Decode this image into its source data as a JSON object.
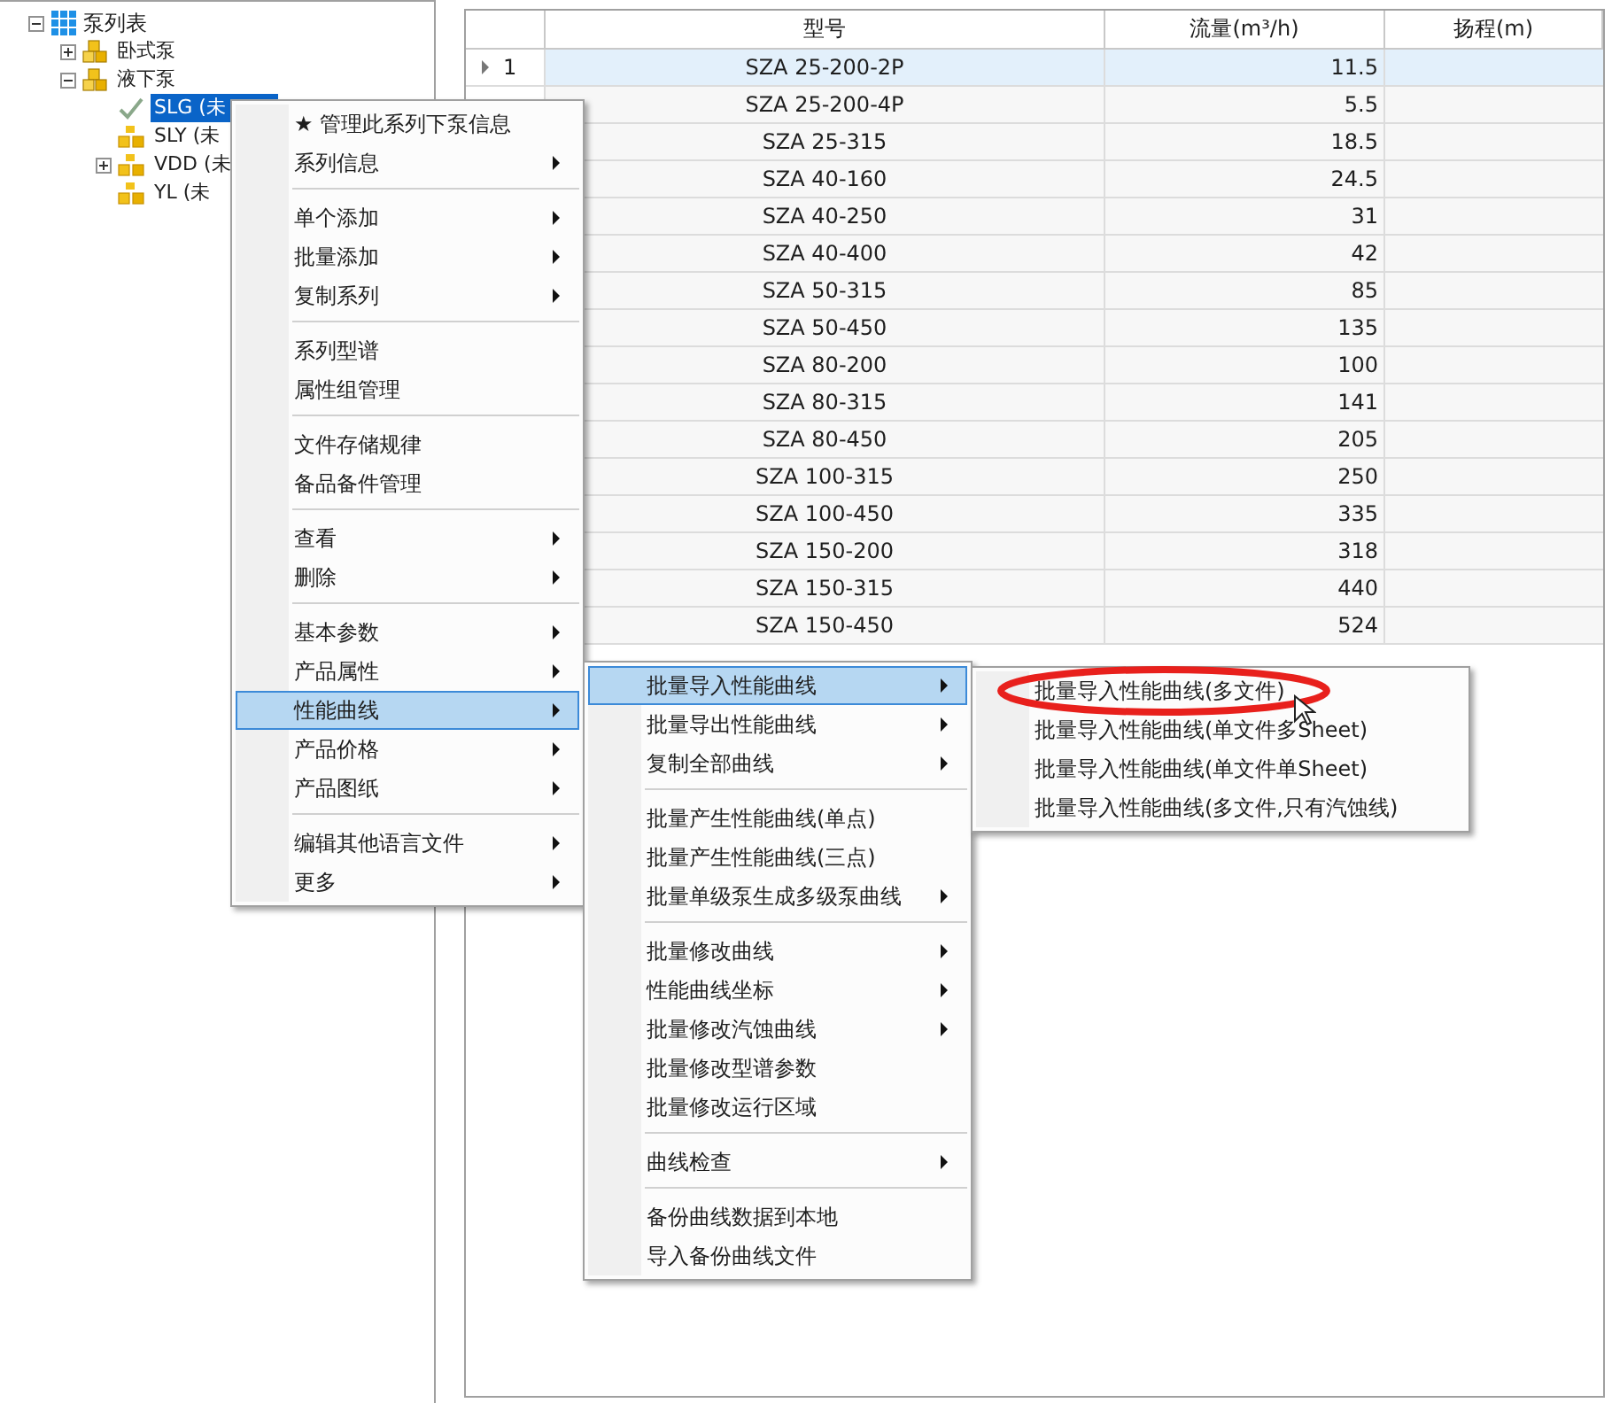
{
  "tree": {
    "label": "泵列表",
    "expanded": true,
    "children": [
      {
        "label": "卧式泵",
        "kind": "folder",
        "expanded": false,
        "has_children": true,
        "selected": false
      },
      {
        "label": "液下泵",
        "kind": "folder",
        "expanded": true,
        "has_children": true,
        "selected": false,
        "children": [
          {
            "label": "SLG (未",
            "kind": "checked",
            "has_children": false,
            "selected": true
          },
          {
            "label": "SLY (未",
            "kind": "series",
            "has_children": false,
            "selected": false
          },
          {
            "label": "VDD (未",
            "kind": "series",
            "has_children": true,
            "expanded": false,
            "selected": false
          },
          {
            "label": "YL (未",
            "kind": "series",
            "has_children": false,
            "selected": false
          }
        ]
      }
    ]
  },
  "grid": {
    "columns": [
      "型号",
      "流量(m³/h)",
      "扬程(m)"
    ],
    "rows": [
      {
        "number": "1",
        "model": "SZA 25-200-2P",
        "flow": "11.5",
        "selected": true
      },
      {
        "model": "SZA 25-200-4P",
        "flow": "5.5",
        "selected": false
      },
      {
        "model": "SZA 25-315",
        "flow": "18.5",
        "selected": false
      },
      {
        "model": "SZA 40-160",
        "flow": "24.5",
        "selected": false
      },
      {
        "model": "SZA 40-250",
        "flow": "31",
        "selected": false
      },
      {
        "model": "SZA 40-400",
        "flow": "42",
        "selected": false
      },
      {
        "model": "SZA 50-315",
        "flow": "85",
        "selected": false
      },
      {
        "model": "SZA 50-450",
        "flow": "135",
        "selected": false
      },
      {
        "model": "SZA 80-200",
        "flow": "100",
        "selected": false
      },
      {
        "model": "SZA 80-315",
        "flow": "141",
        "selected": false
      },
      {
        "model": "SZA 80-450",
        "flow": "205",
        "selected": false
      },
      {
        "model": "SZA 100-315",
        "flow": "250",
        "selected": false
      },
      {
        "model": "SZA 100-450",
        "flow": "335",
        "selected": false
      },
      {
        "model": "SZA 150-200",
        "flow": "318",
        "selected": false
      },
      {
        "model": "SZA 150-315",
        "flow": "440",
        "selected": false
      },
      {
        "model": "SZA 150-450",
        "flow": "524",
        "selected": false
      }
    ]
  },
  "context_menu": {
    "groups": [
      [
        {
          "label": "★ 管理此系列下泵信息",
          "submenu": false,
          "selected": false
        },
        {
          "label": "系列信息",
          "submenu": true,
          "selected": false
        }
      ],
      [
        {
          "label": "单个添加",
          "submenu": true,
          "selected": false
        },
        {
          "label": "批量添加",
          "submenu": true,
          "selected": false
        },
        {
          "label": "复制系列",
          "submenu": true,
          "selected": false
        }
      ],
      [
        {
          "label": "系列型谱",
          "submenu": false,
          "selected": false
        },
        {
          "label": "属性组管理",
          "submenu": false,
          "selected": false
        }
      ],
      [
        {
          "label": "文件存储规律",
          "submenu": false,
          "selected": false
        },
        {
          "label": "备品备件管理",
          "submenu": false,
          "selected": false
        }
      ],
      [
        {
          "label": "查看",
          "submenu": true,
          "selected": false
        },
        {
          "label": "删除",
          "submenu": true,
          "selected": false
        }
      ],
      [
        {
          "label": "基本参数",
          "submenu": true,
          "selected": false
        },
        {
          "label": "产品属性",
          "submenu": true,
          "selected": false
        },
        {
          "label": "性能曲线",
          "submenu": true,
          "selected": true
        },
        {
          "label": "产品价格",
          "submenu": true,
          "selected": false
        },
        {
          "label": "产品图纸",
          "submenu": true,
          "selected": false
        }
      ],
      [
        {
          "label": "编辑其他语言文件",
          "submenu": true,
          "selected": false
        },
        {
          "label": "更多",
          "submenu": true,
          "selected": false
        }
      ]
    ]
  },
  "submenu": {
    "groups": [
      [
        {
          "label": "批量导入性能曲线",
          "submenu": true,
          "selected": true
        },
        {
          "label": "批量导出性能曲线",
          "submenu": true,
          "selected": false
        },
        {
          "label": "复制全部曲线",
          "submenu": true,
          "selected": false
        }
      ],
      [
        {
          "label": "批量产生性能曲线(单点)",
          "submenu": false,
          "selected": false
        },
        {
          "label": "批量产生性能曲线(三点)",
          "submenu": false,
          "selected": false
        },
        {
          "label": "批量单级泵生成多级泵曲线",
          "submenu": true,
          "selected": false
        }
      ],
      [
        {
          "label": "批量修改曲线",
          "submenu": true,
          "selected": false
        },
        {
          "label": "性能曲线坐标",
          "submenu": true,
          "selected": false
        },
        {
          "label": "批量修改汽蚀曲线",
          "submenu": true,
          "selected": false
        },
        {
          "label": "批量修改型谱参数",
          "submenu": false,
          "selected": false
        },
        {
          "label": "批量修改运行区域",
          "submenu": false,
          "selected": false
        }
      ],
      [
        {
          "label": "曲线检查",
          "submenu": true,
          "selected": false
        }
      ],
      [
        {
          "label": "备份曲线数据到本地",
          "submenu": false,
          "selected": false
        },
        {
          "label": "导入备份曲线文件",
          "submenu": false,
          "selected": false
        }
      ]
    ]
  },
  "import_menu": {
    "groups": [
      [
        {
          "label": "批量导入性能曲线(多文件)",
          "submenu": false,
          "selected": false,
          "highlighted": true
        },
        {
          "label": "批量导入性能曲线(单文件多Sheet)",
          "submenu": false,
          "selected": false
        },
        {
          "label": "批量导入性能曲线(单文件单Sheet)",
          "submenu": false,
          "selected": false
        },
        {
          "label": "批量导入性能曲线(多文件,只有汽蚀线)",
          "submenu": false,
          "selected": false
        }
      ]
    ]
  }
}
